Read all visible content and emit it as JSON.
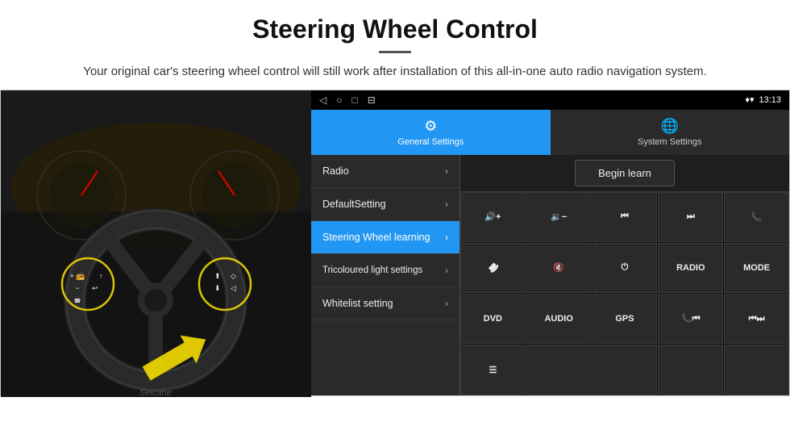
{
  "header": {
    "title": "Steering Wheel Control",
    "divider": "",
    "subtitle": "Your original car's steering wheel control will still work after installation of this all-in-one auto radio navigation system."
  },
  "status_bar": {
    "nav_icons": [
      "◁",
      "○",
      "□",
      "⊟"
    ],
    "right_icons": "♦ ▾",
    "time": "13:13"
  },
  "tabs": [
    {
      "label": "General Settings",
      "active": true
    },
    {
      "label": "System Settings",
      "active": false
    }
  ],
  "menu_items": [
    {
      "label": "Radio",
      "active": false
    },
    {
      "label": "DefaultSetting",
      "active": false
    },
    {
      "label": "Steering Wheel learning",
      "active": true
    },
    {
      "label": "Tricoloured light settings",
      "active": false
    },
    {
      "label": "Whitelist setting",
      "active": false
    }
  ],
  "begin_learn_btn": "Begin learn",
  "button_grid": [
    [
      {
        "label": "🔊+",
        "type": "icon"
      },
      {
        "label": "🔉−",
        "type": "icon"
      },
      {
        "label": "⏮",
        "type": "icon"
      },
      {
        "label": "⏭",
        "type": "icon"
      },
      {
        "label": "📞",
        "type": "icon"
      }
    ],
    [
      {
        "label": "↩",
        "type": "icon"
      },
      {
        "label": "🔇×",
        "type": "icon"
      },
      {
        "label": "⏻",
        "type": "icon"
      },
      {
        "label": "RADIO",
        "type": "text"
      },
      {
        "label": "MODE",
        "type": "text"
      }
    ],
    [
      {
        "label": "DVD",
        "type": "text"
      },
      {
        "label": "AUDIO",
        "type": "text"
      },
      {
        "label": "GPS",
        "type": "text"
      },
      {
        "label": "📞⏮",
        "type": "icon"
      },
      {
        "label": "⏮⏭",
        "type": "icon"
      }
    ],
    [
      {
        "label": "📋",
        "type": "icon"
      },
      {
        "label": "",
        "type": "empty"
      },
      {
        "label": "",
        "type": "empty"
      },
      {
        "label": "",
        "type": "empty"
      },
      {
        "label": "",
        "type": "empty"
      }
    ]
  ],
  "car_image_alt": "Steering wheel car image"
}
